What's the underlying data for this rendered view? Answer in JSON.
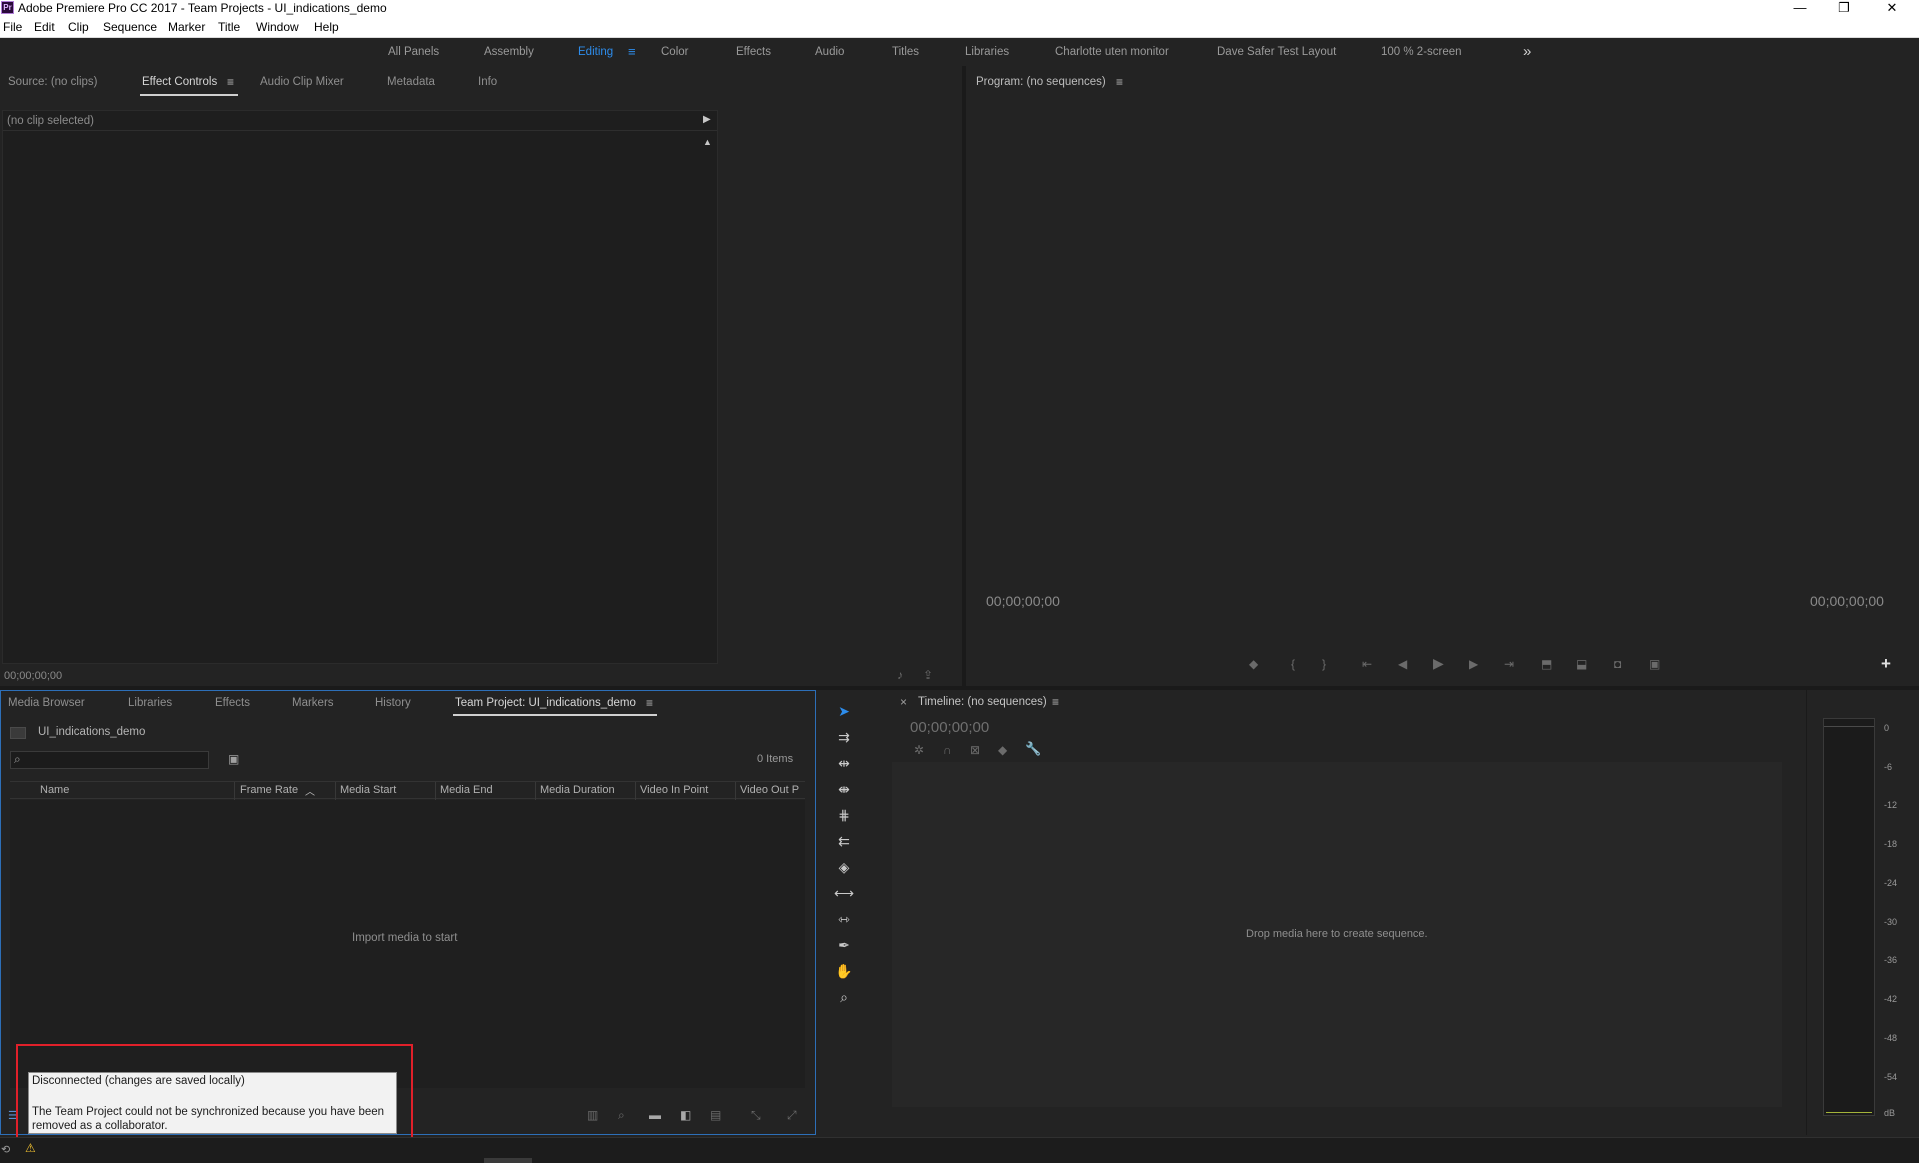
{
  "window": {
    "app_icon": "Pr",
    "title": "Adobe Premiere Pro CC 2017 - Team Projects - UI_indications_demo",
    "minimize": "—",
    "restore": "❐",
    "close": "✕"
  },
  "menu": [
    "File",
    "Edit",
    "Clip",
    "Sequence",
    "Marker",
    "Title",
    "Window",
    "Help"
  ],
  "workspaces": {
    "items": [
      "All Panels",
      "Assembly",
      "Editing",
      "Color",
      "Effects",
      "Audio",
      "Titles",
      "Libraries",
      "Charlotte uten monitor",
      "Dave Safer Test Layout",
      "100 % 2-screen"
    ],
    "active": "Editing",
    "overflow": "»"
  },
  "source_panel": {
    "tabs": [
      "Source: (no clips)",
      "Effect Controls",
      "Audio Clip Mixer",
      "Metadata",
      "Info"
    ],
    "active_tab": "Effect Controls",
    "clip_label": "(no clip selected)",
    "timecode": "00;00;00;00"
  },
  "program_panel": {
    "title": "Program: (no sequences)",
    "timecode_left": "00;00;00;00",
    "timecode_right": "00;00;00;00",
    "add_button": "+"
  },
  "project_panel": {
    "tabs": [
      "Media Browser",
      "Libraries",
      "Effects",
      "Markers",
      "History",
      "Team Project: UI_indications_demo"
    ],
    "active_tab": "Team Project: UI_indications_demo",
    "bin_name": "UI_indications_demo",
    "search_placeholder": "",
    "item_count": "0 Items",
    "columns": [
      "Name",
      "Frame Rate",
      "Media Start",
      "Media End",
      "Media Duration",
      "Video In Point",
      "Video Out P"
    ],
    "sorted_column": "Frame Rate",
    "empty_message": "Import media to start"
  },
  "timeline_panel": {
    "close": "×",
    "title": "Timeline: (no sequences)",
    "timecode": "00;00;00;00",
    "empty_message": "Drop media here to create sequence."
  },
  "audio_meter": {
    "ticks": [
      "0",
      "-6",
      "-12",
      "-18",
      "-24",
      "-30",
      "-36",
      "-42",
      "-48",
      "-54",
      "dB"
    ]
  },
  "tooltip": {
    "heading": "Disconnected (changes are saved locally)",
    "body": "The Team Project could not be synchronized because you have been removed as a collaborator."
  },
  "status_bar": {
    "warning_icon": "⚠"
  },
  "colors": {
    "accent_blue": "#2d8ceb",
    "highlight_red": "#e0202a",
    "panel_bg": "#232323",
    "warning_yellow": "#f2c230"
  }
}
